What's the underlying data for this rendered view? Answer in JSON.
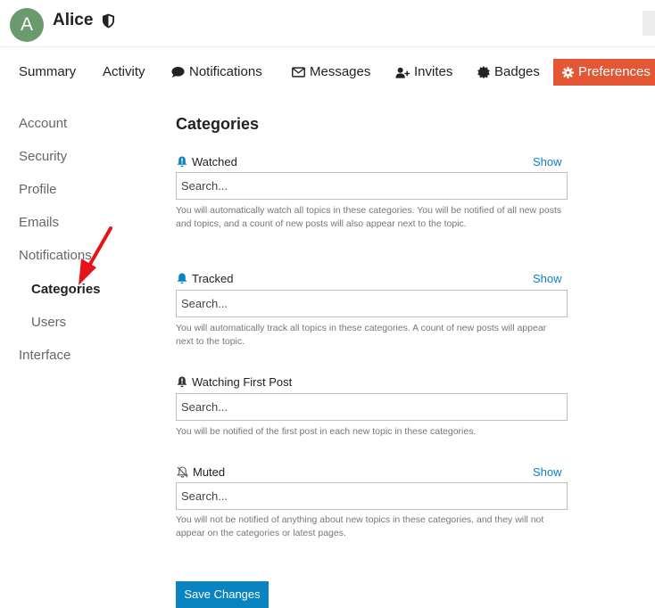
{
  "user": {
    "avatar_letter": "A",
    "name": "Alice",
    "avatar_color": "#6b9a6e"
  },
  "nav": {
    "summary": "Summary",
    "activity": "Activity",
    "notifications": "Notifications",
    "messages": "Messages",
    "invites": "Invites",
    "badges": "Badges",
    "preferences": "Preferences",
    "active_color": "#e45735"
  },
  "sidebar": {
    "items": [
      {
        "label": "Account"
      },
      {
        "label": "Security"
      },
      {
        "label": "Profile"
      },
      {
        "label": "Emails"
      },
      {
        "label": "Notifications"
      },
      {
        "label": "Categories"
      },
      {
        "label": "Users"
      },
      {
        "label": "Interface"
      }
    ],
    "active": "Categories"
  },
  "main": {
    "title": "Categories",
    "groups": [
      {
        "label": "Watched",
        "icon": "bell-exclamation-icon",
        "show": "Show",
        "placeholder": "Search...",
        "help": "You will automatically watch all topics in these categories. You will be notified of all new posts and topics, and a count of new posts will also appear next to the topic."
      },
      {
        "label": "Tracked",
        "icon": "bell-icon",
        "show": "Show",
        "placeholder": "Search...",
        "help": "You will automatically track all topics in these categories. A count of new posts will appear next to the topic."
      },
      {
        "label": "Watching First Post",
        "icon": "bell-exclamation-icon",
        "show": "",
        "placeholder": "Search...",
        "help": "You will be notified of the first post in each new topic in these categories."
      },
      {
        "label": "Muted",
        "icon": "bell-slash-icon",
        "show": "Show",
        "placeholder": "Search...",
        "help": "You will not be notified of anything about new topics in these categories, and they will not appear on the categories or latest pages."
      }
    ],
    "save_label": "Save Changes",
    "link_color": "#0a84c1"
  },
  "annotation": {
    "arrow_color": "#e8121b"
  }
}
